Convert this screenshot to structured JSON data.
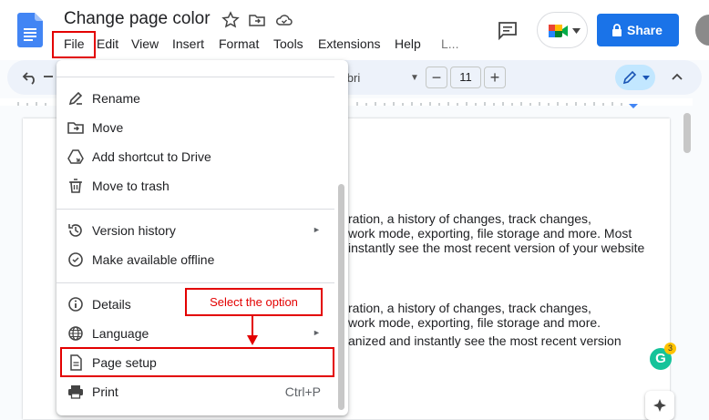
{
  "header": {
    "doc_title": "Change page color",
    "menu": [
      "File",
      "Edit",
      "View",
      "Insert",
      "Format",
      "Tools",
      "Extensions",
      "Help",
      "L..."
    ],
    "share_label": "Share"
  },
  "toolbar": {
    "font_name": "libri",
    "font_size": "11",
    "minus": "−",
    "plus": "+"
  },
  "document": {
    "lines": [
      "ration, a history of changes, track changes,",
      "work mode, exporting, file storage and more. Most",
      "instantly see the most recent version of your website",
      "ration, a history of changes, track changes,",
      "work mode, exporting, file storage and more.",
      "anized and instantly see the most recent version"
    ],
    "grammarly_count": "3"
  },
  "file_menu": {
    "items": [
      {
        "label": "Rename",
        "icon": "rename-icon"
      },
      {
        "label": "Move",
        "icon": "move-folder-icon"
      },
      {
        "label": "Add shortcut to Drive",
        "icon": "drive-shortcut-icon"
      },
      {
        "label": "Move to trash",
        "icon": "trash-icon"
      },
      {
        "label": "Version history",
        "icon": "history-icon",
        "submenu": true
      },
      {
        "label": "Make available offline",
        "icon": "offline-icon"
      },
      {
        "label": "Details",
        "icon": "info-icon"
      },
      {
        "label": "Language",
        "icon": "globe-icon",
        "submenu": true
      },
      {
        "label": "Page setup",
        "icon": "page-icon"
      },
      {
        "label": "Print",
        "icon": "print-icon",
        "shortcut": "Ctrl+P"
      }
    ],
    "submenu_arrow": "►"
  },
  "annotation": {
    "callout_text": "Select the option",
    "color": "#e30000"
  },
  "colors": {
    "accent": "#1a73e8",
    "toolbar_bg": "#edf2fa"
  }
}
